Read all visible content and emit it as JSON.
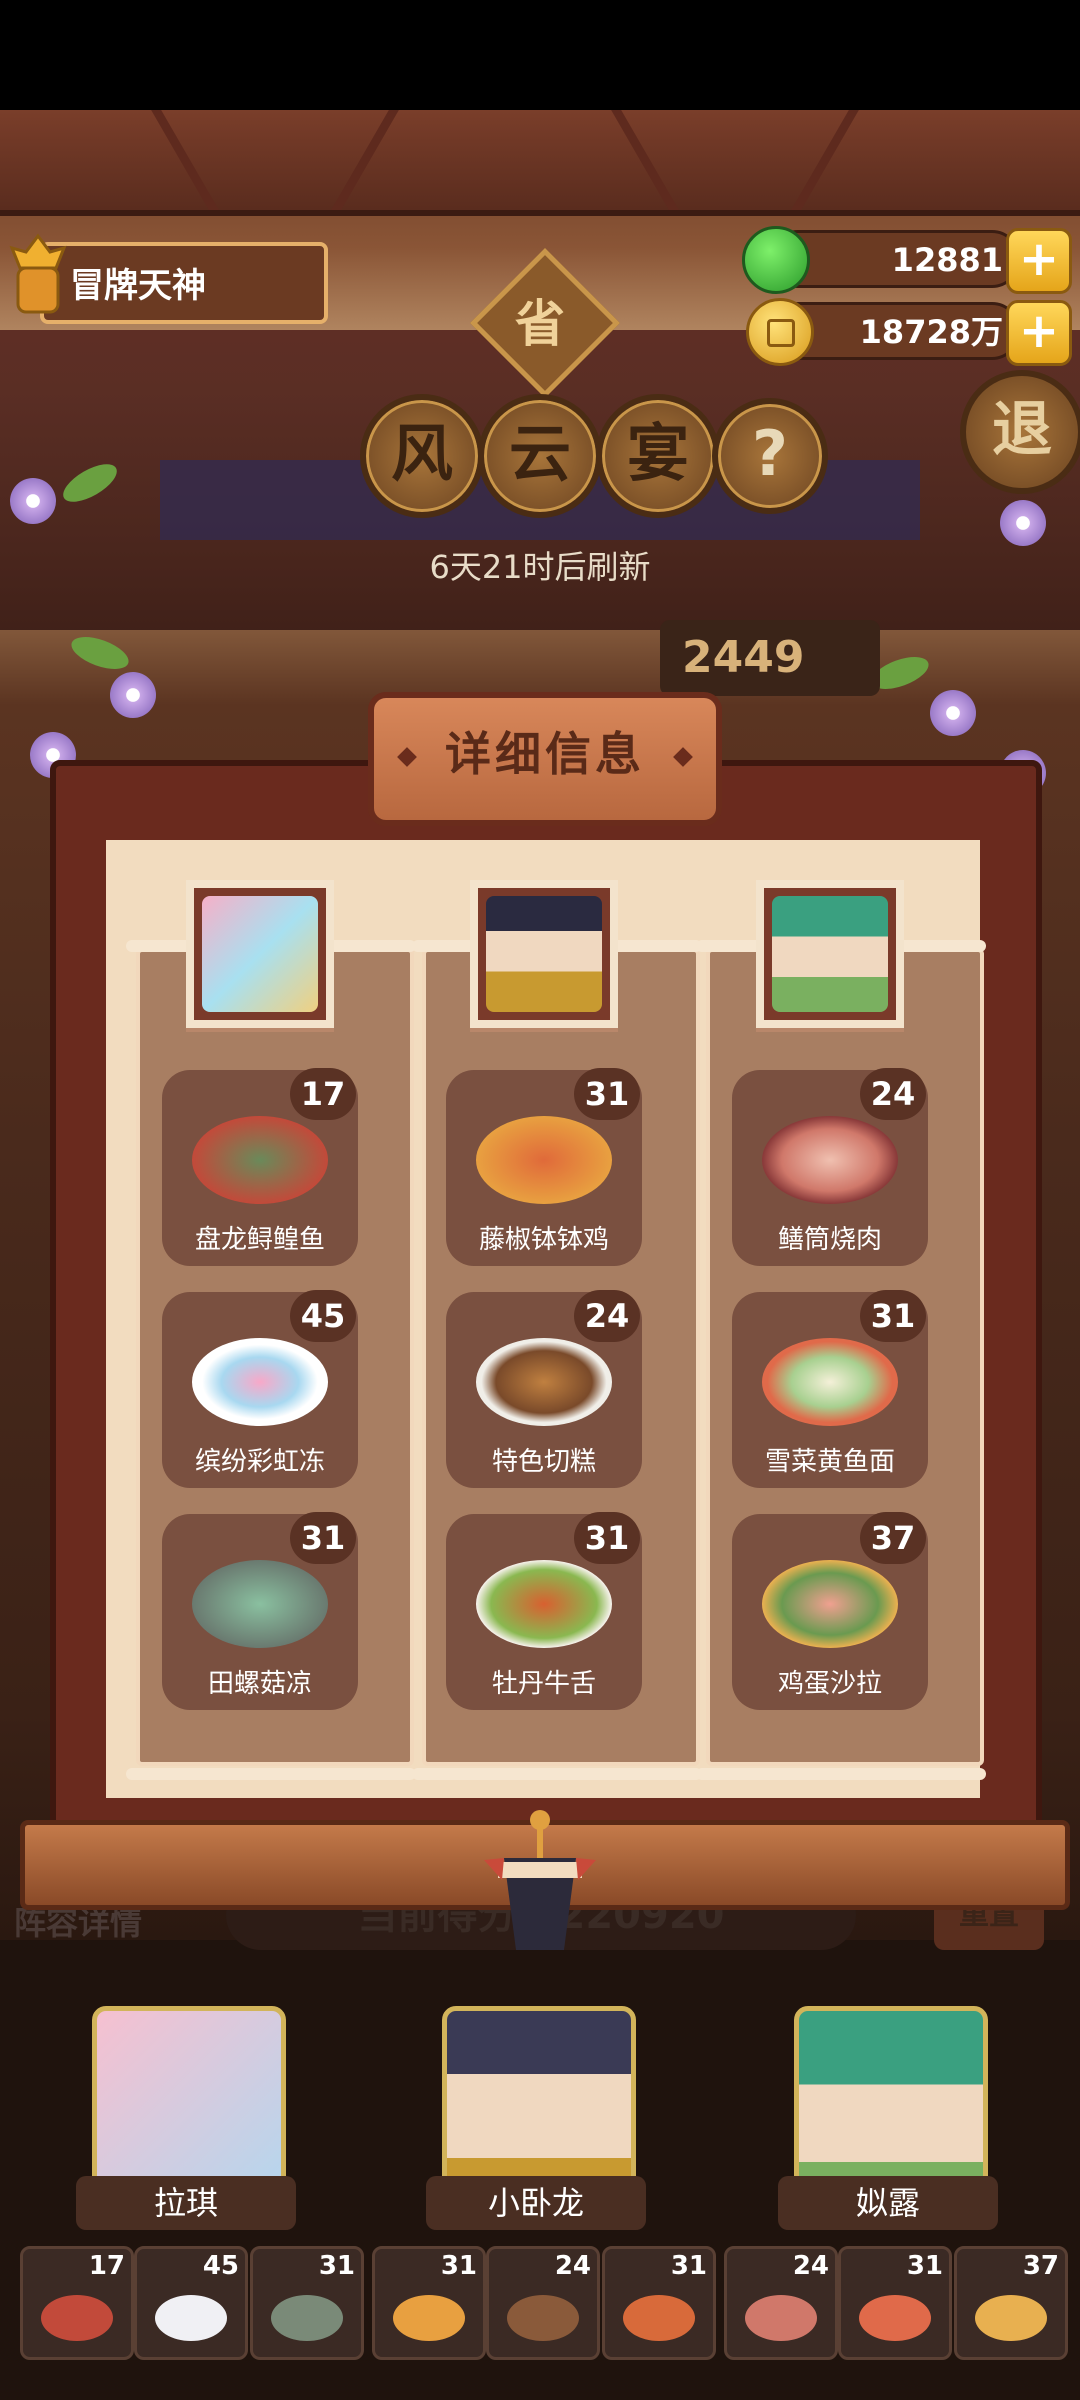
{
  "player": {
    "title": "冒牌天神"
  },
  "currency": {
    "gems": "12881",
    "coins": "18728万",
    "plus": "+"
  },
  "province": {
    "label": "省"
  },
  "event": {
    "title_chars": [
      "风",
      "云",
      "宴"
    ],
    "help": "?",
    "refresh_text": "6天21时后刷新"
  },
  "exit_label": "退",
  "partial_score": "2449",
  "panel": {
    "title": "详细信息"
  },
  "chefs": [
    {
      "name": "拉琪",
      "dishes": [
        {
          "name": "盘龙鲟鳇鱼",
          "count": "17"
        },
        {
          "name": "缤纷彩虹冻",
          "count": "45"
        },
        {
          "name": "田螺菇凉",
          "count": "31"
        }
      ]
    },
    {
      "name": "小卧龙",
      "dishes": [
        {
          "name": "藤椒钵钵鸡",
          "count": "31"
        },
        {
          "name": "特色切糕",
          "count": "24"
        },
        {
          "name": "牡丹牛舌",
          "count": "31"
        }
      ]
    },
    {
      "name": "姒露",
      "dishes": [
        {
          "name": "鳝筒烧肉",
          "count": "24"
        },
        {
          "name": "雪菜黄鱼面",
          "count": "31"
        },
        {
          "name": "鸡蛋沙拉",
          "count": "37"
        }
      ]
    }
  ],
  "lower": {
    "lineup_label": "阵容详情",
    "score_text": "当前得分：220920",
    "reset_label": "重置"
  },
  "slot_counts": [
    "17",
    "45",
    "31",
    "31",
    "24",
    "31",
    "24",
    "31",
    "37"
  ],
  "colors": {
    "panel": "#6a2a1e",
    "paper": "#f2dcbf",
    "scroll": "#a87e62",
    "badge": "#5a3224",
    "accent_gold": "#e5a51a"
  }
}
